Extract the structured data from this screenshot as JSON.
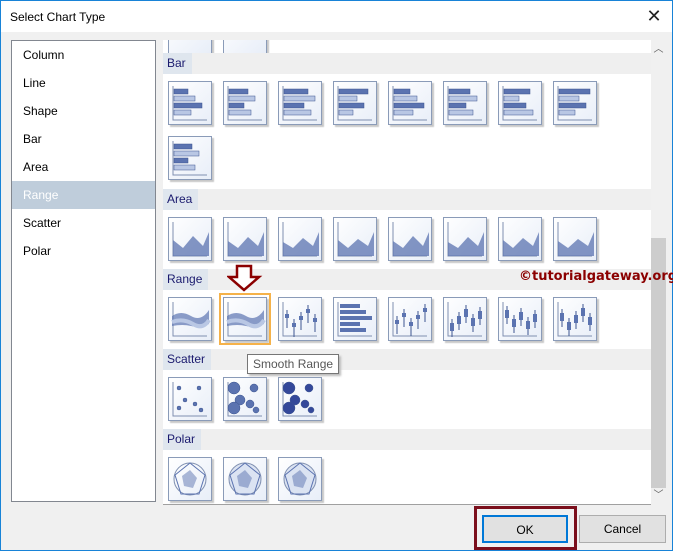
{
  "window": {
    "title": "Select Chart Type",
    "close_label": "✕"
  },
  "categories": [
    {
      "label": "Column"
    },
    {
      "label": "Line"
    },
    {
      "label": "Shape"
    },
    {
      "label": "Bar"
    },
    {
      "label": "Area"
    },
    {
      "label": "Range",
      "selected": true
    },
    {
      "label": "Scatter"
    },
    {
      "label": "Polar"
    }
  ],
  "sections": {
    "bar": {
      "label": "Bar",
      "icons": [
        "bar-clustered",
        "bar-stacked",
        "bar-stacked-100",
        "bar-3d-clustered",
        "bar-3d-stacked",
        "bar-3d",
        "bar-cylinder",
        "bar-cylinder-stacked",
        "bar-cylinder-clustered"
      ]
    },
    "area": {
      "label": "Area",
      "icons": [
        "area",
        "smooth-area",
        "stacked-area",
        "area-100",
        "area-3d",
        "smooth-area-3d",
        "stacked-area-3d",
        "area-3d-100"
      ]
    },
    "range": {
      "label": "Range",
      "icons": [
        "range",
        "smooth-range",
        "range-column",
        "range-bar",
        "stock",
        "candlestick",
        "error-bar",
        "box-plot"
      ]
    },
    "scatter": {
      "label": "Scatter",
      "icons": [
        "scatter",
        "bubble",
        "bubble-3d"
      ]
    },
    "polar": {
      "label": "Polar",
      "icons": [
        "radar",
        "polar",
        "polar-3d"
      ]
    }
  },
  "tooltip": "Smooth Range",
  "watermark": "©tutorialgateway.org",
  "buttons": {
    "ok": "OK",
    "cancel": "Cancel"
  },
  "colors": {
    "accent": "#1883d7",
    "highlight": "#7b0f1c",
    "selection": "#bfcddb",
    "icon": "#5b73b0"
  }
}
